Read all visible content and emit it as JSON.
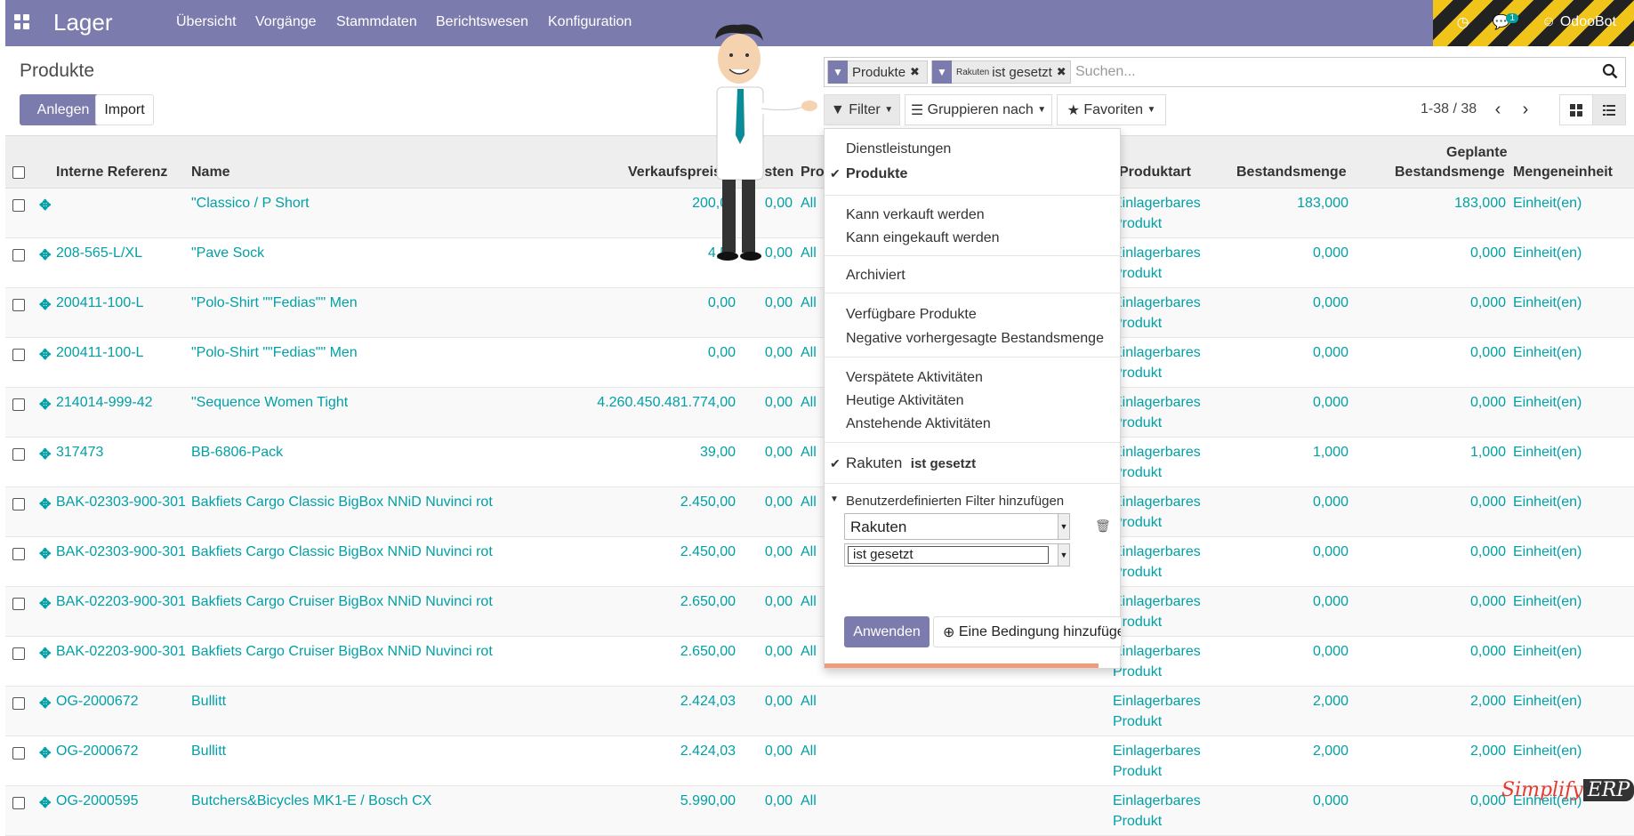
{
  "app": {
    "title": "Lager"
  },
  "menu": [
    "Übersicht",
    "Vorgänge",
    "Stammdaten",
    "Berichtswesen",
    "Konfiguration"
  ],
  "systray": {
    "user": "OdooBot",
    "message_count": "1"
  },
  "page": {
    "title": "Produkte",
    "create_label": "Anlegen",
    "import_label": "Import"
  },
  "search": {
    "facets": [
      {
        "value": "Produkte"
      },
      {
        "field": "Rakuten",
        "value": "ist gesetzt"
      }
    ],
    "placeholder": "Suchen..."
  },
  "controls": {
    "filter": "Filter",
    "group_by": "Gruppieren nach",
    "favorites": "Favoriten",
    "pager": "1-38 / 38"
  },
  "filter_menu": {
    "groups": [
      [
        {
          "label": "Dienstleistungen",
          "checked": false
        },
        {
          "label": "Produkte",
          "checked": true
        }
      ],
      [
        {
          "label": "Kann verkauft werden",
          "checked": false
        },
        {
          "label": "Kann eingekauft werden",
          "checked": false
        }
      ],
      [
        {
          "label": "Archiviert",
          "checked": false
        }
      ],
      [
        {
          "label": "Verfügbare Produkte",
          "checked": false
        },
        {
          "label": "Negative vorhergesagte Bestandsmenge",
          "checked": false
        }
      ],
      [
        {
          "label": "Verspätete Aktivitäten",
          "checked": false
        },
        {
          "label": "Heutige Aktivitäten",
          "checked": false
        },
        {
          "label": "Anstehende Aktivitäten",
          "checked": false
        }
      ]
    ],
    "custom_active": {
      "field": "Rakuten",
      "op": "ist gesetzt"
    },
    "custom_toggle": "Benutzerdefinierten Filter hinzufügen",
    "field_value": "Rakuten",
    "operator_value": "ist gesetzt",
    "apply": "Anwenden",
    "add_condition": "Eine Bedingung hinzufüge"
  },
  "table": {
    "headers": {
      "ref": "Interne Referenz",
      "name": "Name",
      "price": "Verkaufspreis",
      "cost": "Kosten",
      "pro": "Pro",
      "type": "Produktart",
      "qty": "Bestandsmenge",
      "planned_1": "Geplante",
      "planned_2": "Bestandsmenge",
      "uom": "Mengeneinheit"
    },
    "rows": [
      {
        "ref": "",
        "name": "\"Classico / P Short",
        "price": "200,00",
        "cost": "0,00",
        "pro": "All",
        "type1": "Einlagerbares",
        "type2": "Produkt",
        "qty": "183,000",
        "planned": "183,000",
        "uom": "Einheit(en)"
      },
      {
        "ref": "208-565-L/XL",
        "name": "\"Pave Sock",
        "price": "4,50",
        "cost": "0,00",
        "pro": "All",
        "type1": "Einlagerbares",
        "type2": "Produkt",
        "qty": "0,000",
        "planned": "0,000",
        "uom": "Einheit(en)"
      },
      {
        "ref": "200411-100-L",
        "name": "\"Polo-Shirt \"\"Fedias\"\" Men",
        "price": "0,00",
        "cost": "0,00",
        "pro": "All",
        "type1": "Einlagerbares",
        "type2": "Produkt",
        "qty": "0,000",
        "planned": "0,000",
        "uom": "Einheit(en)"
      },
      {
        "ref": "200411-100-L",
        "name": "\"Polo-Shirt \"\"Fedias\"\" Men",
        "price": "0,00",
        "cost": "0,00",
        "pro": "All",
        "type1": "Einlagerbares",
        "type2": "Produkt",
        "qty": "0,000",
        "planned": "0,000",
        "uom": "Einheit(en)"
      },
      {
        "ref": "214014-999-42",
        "name": "\"Sequence Women Tight",
        "price": "4.260.450.481.774,00",
        "cost": "0,00",
        "pro": "All",
        "type1": "Einlagerbares",
        "type2": "Produkt",
        "qty": "0,000",
        "planned": "0,000",
        "uom": "Einheit(en)"
      },
      {
        "ref": "317473",
        "name": "BB-6806-Pack",
        "price": "39,00",
        "cost": "0,00",
        "pro": "All",
        "type1": "Einlagerbares",
        "type2": "Produkt",
        "qty": "1,000",
        "planned": "1,000",
        "uom": "Einheit(en)"
      },
      {
        "ref": "BAK-02303-900-301",
        "name": "Bakfiets Cargo Classic BigBox NNiD Nuvinci rot",
        "price": "2.450,00",
        "cost": "0,00",
        "pro": "All",
        "type1": "Einlagerbares",
        "type2": "Produkt",
        "qty": "0,000",
        "planned": "0,000",
        "uom": "Einheit(en)"
      },
      {
        "ref": "BAK-02303-900-301",
        "name": "Bakfiets Cargo Classic BigBox NNiD Nuvinci rot",
        "price": "2.450,00",
        "cost": "0,00",
        "pro": "All",
        "type1": "Einlagerbares",
        "type2": "Produkt",
        "qty": "0,000",
        "planned": "0,000",
        "uom": "Einheit(en)"
      },
      {
        "ref": "BAK-02203-900-301",
        "name": "Bakfiets Cargo Cruiser BigBox NNiD Nuvinci rot",
        "price": "2.650,00",
        "cost": "0,00",
        "pro": "All",
        "type1": "Einlagerbares",
        "type2": "Produkt",
        "qty": "0,000",
        "planned": "0,000",
        "uom": "Einheit(en)"
      },
      {
        "ref": "BAK-02203-900-301",
        "name": "Bakfiets Cargo Cruiser BigBox NNiD Nuvinci rot",
        "price": "2.650,00",
        "cost": "0,00",
        "pro": "All",
        "type1": "Einlagerbares",
        "type2": "Produkt",
        "qty": "0,000",
        "planned": "0,000",
        "uom": "Einheit(en)"
      },
      {
        "ref": "OG-2000672",
        "name": "Bullitt",
        "price": "2.424,03",
        "cost": "0,00",
        "pro": "All",
        "type1": "Einlagerbares",
        "type2": "Produkt",
        "qty": "2,000",
        "planned": "2,000",
        "uom": "Einheit(en)"
      },
      {
        "ref": "OG-2000672",
        "name": "Bullitt",
        "price": "2.424,03",
        "cost": "0,00",
        "pro": "All",
        "type1": "Einlagerbares",
        "type2": "Produkt",
        "qty": "2,000",
        "planned": "2,000",
        "uom": "Einheit(en)"
      },
      {
        "ref": "OG-2000595",
        "name": "Butchers&Bicycles MK1-E / Bosch CX",
        "price": "5.990,00",
        "cost": "0,00",
        "pro": "All",
        "type1": "Einlagerbares",
        "type2": "Produkt",
        "qty": "0,000",
        "planned": "0,000",
        "uom": "Einheit(en)"
      }
    ]
  },
  "watermark": {
    "part1": "Simplify",
    "part2": "ERP"
  },
  "colors": {
    "brand": "#7c7bad",
    "link": "#01a0a7",
    "accent": "#f09b7a"
  }
}
